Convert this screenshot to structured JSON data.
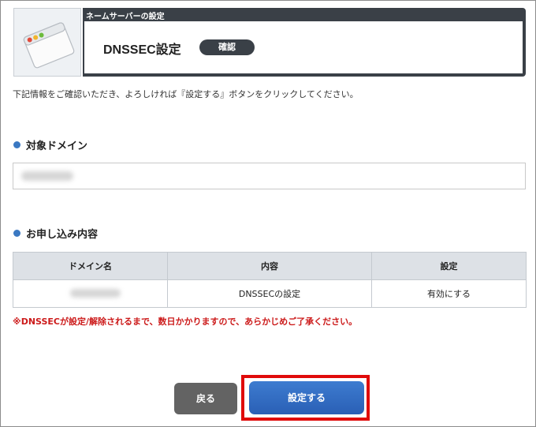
{
  "header": {
    "category": "ネームサーバーの設定",
    "title": "DNSSEC設定",
    "badge": "確認"
  },
  "instruction": "下記情報をご確認いただき、よろしければ『設定する』ボタンをクリックしてください。",
  "domain_section": {
    "title": "対象ドメイン"
  },
  "order_section": {
    "title": "お申し込み内容",
    "columns": [
      "ドメイン名",
      "内容",
      "設定"
    ],
    "rows": [
      {
        "content": "DNSSECの設定",
        "setting": "有効にする"
      }
    ]
  },
  "warning": "※DNSSECが設定/解除されるまで、数日かかりますので、あらかじめご了承ください。",
  "buttons": {
    "back": "戻る",
    "submit": "設定する"
  },
  "colors": {
    "accent_blue": "#2a5fb5",
    "warning_red": "#cc1a1a",
    "highlight_red": "#e00a0a",
    "header_dark": "#3a4047"
  }
}
